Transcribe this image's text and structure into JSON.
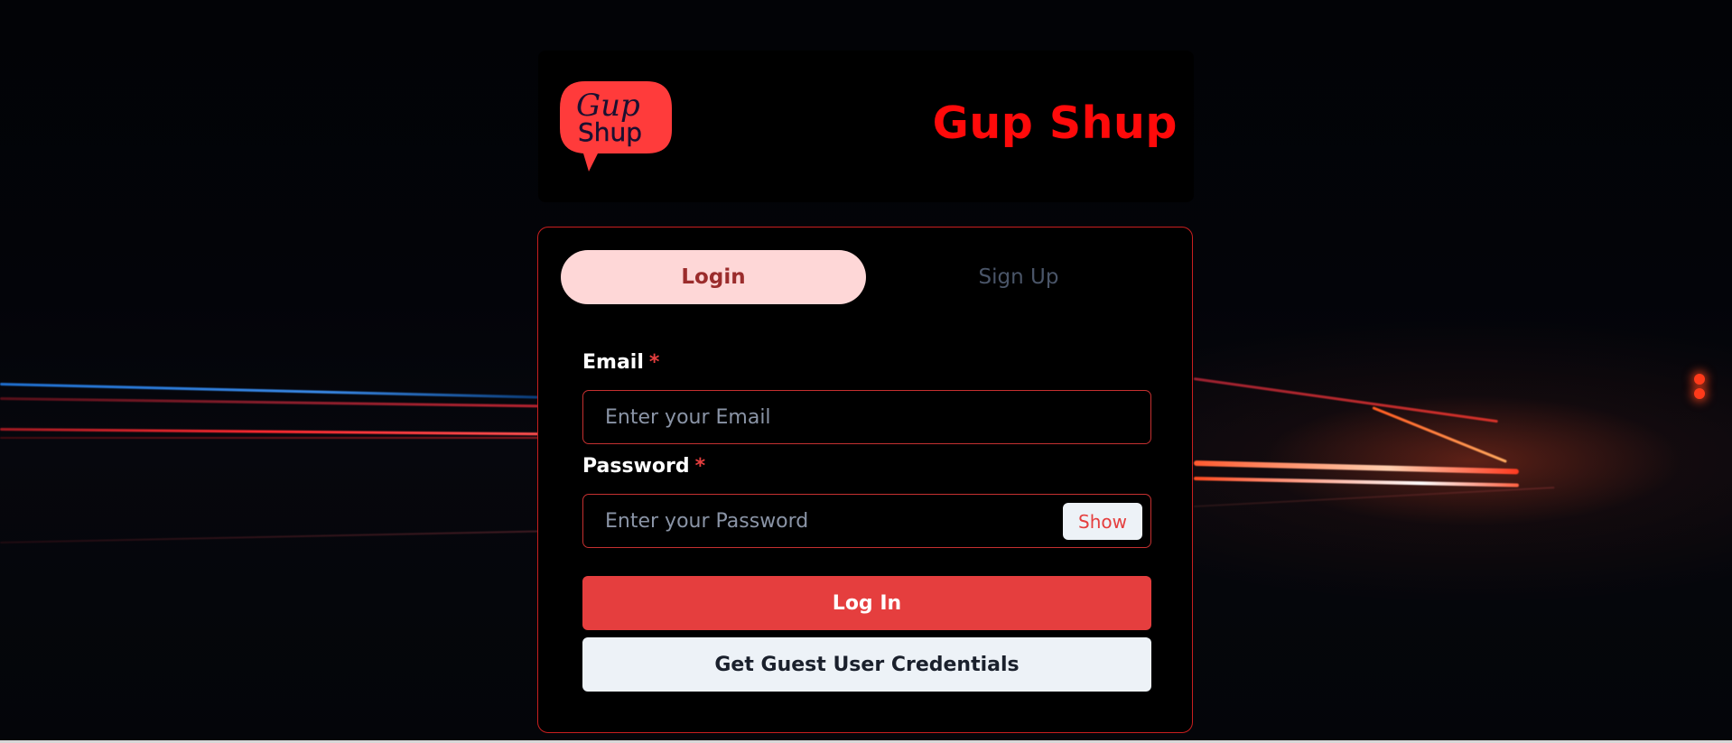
{
  "app": {
    "title": "Gup Shup",
    "logo_text_top": "Gup",
    "logo_text_bottom": "Shup",
    "brand_color": "#ff0a0a",
    "accent_color": "#e53e3e"
  },
  "tabs": [
    {
      "label": "Login",
      "selected": true
    },
    {
      "label": "Sign Up",
      "selected": false
    }
  ],
  "form": {
    "email": {
      "label": "Email",
      "required_mark": "*",
      "value": "",
      "placeholder": "Enter your Email"
    },
    "password": {
      "label": "Password",
      "required_mark": "*",
      "value": "",
      "placeholder": "Enter your Password",
      "toggle_label": "Show"
    },
    "submit_label": "Log In",
    "guest_label": "Get Guest User Credentials"
  }
}
